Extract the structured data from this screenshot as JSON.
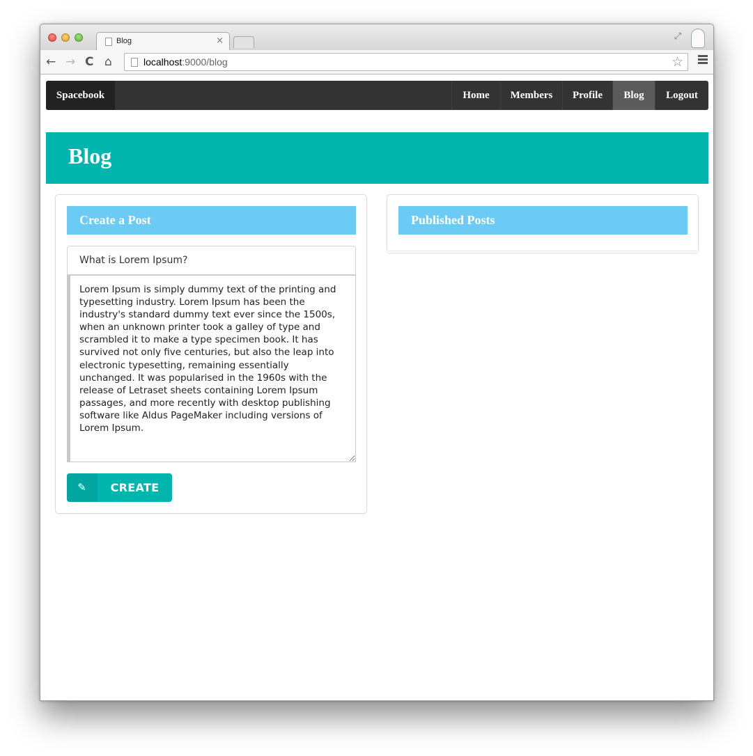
{
  "browser": {
    "tab_title": "Blog",
    "tab_close": "×",
    "url_host": "localhost",
    "url_path": ":9000/blog",
    "star_icon": "☆",
    "back_icon": "←",
    "forward_icon": "→",
    "reload_icon": "C",
    "home_icon": "⌂",
    "fullscreen_icon": "⤢"
  },
  "navbar": {
    "brand": "Spacebook",
    "items": [
      {
        "label": "Home",
        "active": false
      },
      {
        "label": "Members",
        "active": false
      },
      {
        "label": "Profile",
        "active": false
      },
      {
        "label": "Blog",
        "active": true
      },
      {
        "label": "Logout",
        "active": false
      }
    ]
  },
  "page": {
    "title": "Blog"
  },
  "create_post": {
    "header": "Create a Post",
    "title_value": "What is Lorem Ipsum?",
    "body_value": "Lorem Ipsum is simply dummy text of the printing and typesetting industry. Lorem Ipsum has been the industry's standard dummy text ever since the 1500s, when an unknown printer took a galley of type and scrambled it to make a type specimen book. It has survived not only five centuries, but also the leap into electronic typesetting, remaining essentially unchanged. It was popularised in the 1960s with the release of Letraset sheets containing Lorem Ipsum passages, and more recently with desktop publishing software like Aldus PageMaker including versions of Lorem Ipsum.",
    "button_label": "CREATE",
    "button_icon": "✎"
  },
  "published_posts": {
    "header": "Published Posts"
  },
  "colors": {
    "navbar_bg": "#333333",
    "accent_teal": "#00b5ad",
    "header_blue": "#6ccbf4",
    "active_nav": "#5b5b5b"
  }
}
